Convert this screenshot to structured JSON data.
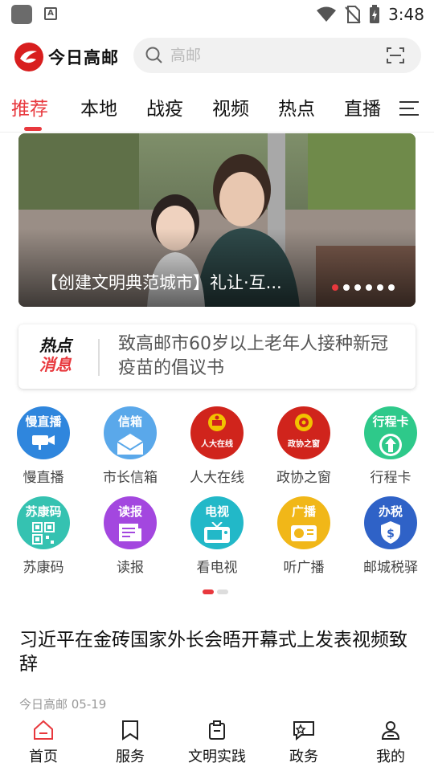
{
  "status_bar": {
    "time": "3:48"
  },
  "header": {
    "logo_text": "今日高邮",
    "search_placeholder": "高邮"
  },
  "tabs": [
    {
      "label": "推荐",
      "active": true
    },
    {
      "label": "本地"
    },
    {
      "label": "战疫"
    },
    {
      "label": "视频"
    },
    {
      "label": "热点"
    },
    {
      "label": "直播"
    }
  ],
  "banner": {
    "caption": "【创建文明典范城市】礼让·互...",
    "slide_count": 6,
    "active_slide": 1
  },
  "hot_news": {
    "badge_line1": "热点",
    "badge_line2": "消息",
    "text": "致高邮市60岁以上老年人接种新冠疫苗的倡议书"
  },
  "services": [
    {
      "label": "慢直播",
      "icon_title": "慢直播",
      "icon": "camera-icon",
      "color": "#2f86dd"
    },
    {
      "label": "市长信箱",
      "icon_title": "信箱",
      "icon": "mail-icon",
      "color": "#5aa8ea"
    },
    {
      "label": "人大在线",
      "icon_title": "人大在线",
      "icon": "national-emblem-icon",
      "color": "#d0241c"
    },
    {
      "label": "政协之窗",
      "icon_title": "政协之窗",
      "icon": "cppcc-emblem-icon",
      "color": "#d0241c"
    },
    {
      "label": "行程卡",
      "icon_title": "行程卡",
      "icon": "arrow-up-icon",
      "color": "#2ec98a"
    },
    {
      "label": "苏康码",
      "icon_title": "苏康码",
      "icon": "qr-code-icon",
      "color": "#35c2b1"
    },
    {
      "label": "读报",
      "icon_title": "读报",
      "icon": "newspaper-icon",
      "color": "#a347df"
    },
    {
      "label": "看电视",
      "icon_title": "电视",
      "icon": "tv-icon",
      "color": "#22b8c8"
    },
    {
      "label": "听广播",
      "icon_title": "广播",
      "icon": "radio-icon",
      "color": "#f1b718"
    },
    {
      "label": "邮城税驿",
      "icon_title": "办税",
      "icon": "tax-icon",
      "color": "#2f62c7"
    }
  ],
  "services_pager": {
    "pages": 2,
    "active": 1
  },
  "article": {
    "title": "习近平在金砖国家外长会晤开幕式上发表视频致辞",
    "meta": "今日高邮 05-19"
  },
  "bottom_nav": [
    {
      "label": "首页",
      "icon": "home-icon",
      "active": true
    },
    {
      "label": "服务",
      "icon": "bookmark-icon"
    },
    {
      "label": "文明实践",
      "icon": "clipboard-icon"
    },
    {
      "label": "政务",
      "icon": "chat-star-icon"
    },
    {
      "label": "我的",
      "icon": "user-icon"
    }
  ],
  "colors": {
    "accent": "#e8383d"
  }
}
